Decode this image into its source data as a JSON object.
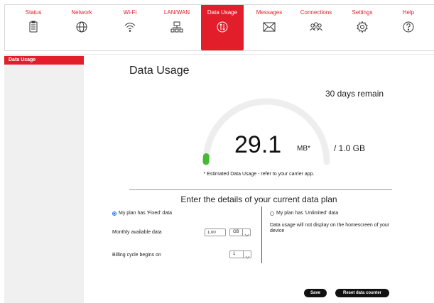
{
  "nav": [
    {
      "label": "Status",
      "icon": "clipboard-icon"
    },
    {
      "label": "Network",
      "icon": "globe-icon"
    },
    {
      "label": "Wi-Fi",
      "icon": "wifi-icon"
    },
    {
      "label": "LAN/WAN",
      "icon": "lan-icon"
    },
    {
      "label": "Data Usage",
      "icon": "data-usage-icon"
    },
    {
      "label": "Messages",
      "icon": "envelope-icon"
    },
    {
      "label": "Connections",
      "icon": "users-icon"
    },
    {
      "label": "Settings",
      "icon": "gear-icon"
    },
    {
      "label": "Help",
      "icon": "help-icon"
    }
  ],
  "sidebar": {
    "items": [
      {
        "label": "Data Usage"
      }
    ]
  },
  "main": {
    "title": "Data Usage",
    "days_remain": "30 days remain",
    "usage_value": "29.1",
    "usage_unit": "MB*",
    "plan_total": "/ 1.0 GB",
    "usage_fraction": 0.028,
    "estimate_note": "* Estimated Data Usage - refer to your carrier app.",
    "section_title": "Enter the details of your current data plan",
    "fixed_option": "My plan has 'Fixed' data",
    "unlimited_option": "My plan has 'Unlimited' data",
    "monthly_label": "Monthly available data",
    "monthly_value": "1.00",
    "monthly_unit": "GB",
    "billing_label": "Billing cycle begins on",
    "billing_value": "1",
    "unlimited_note": "Data usage will not display on the homescreen of your device",
    "save_label": "Save",
    "reset_label": "Reset data counter"
  },
  "colors": {
    "accent": "#e21e2b",
    "gauge_track": "#eeeeee",
    "gauge_fill": "#44bb33",
    "radio": "#1a73e8"
  }
}
